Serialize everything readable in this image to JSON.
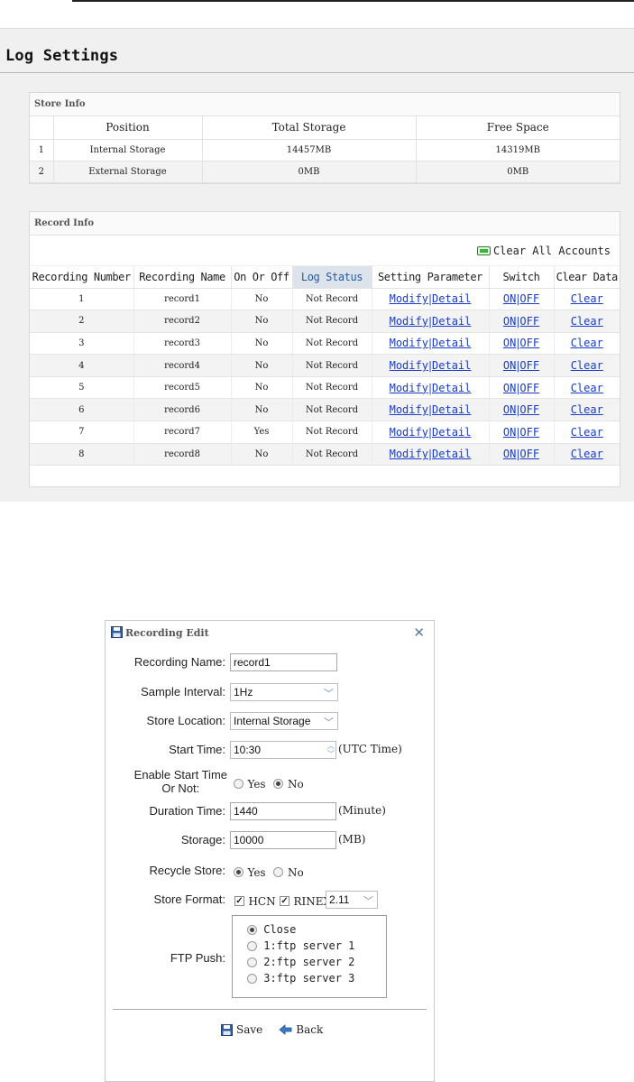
{
  "log_settings": {
    "title": "Log Settings",
    "store_info": {
      "heading": "Store Info",
      "columns": [
        "",
        "Position",
        "Total Storage",
        "Free Space"
      ],
      "rows": [
        {
          "index": "1",
          "position": "Internal Storage",
          "total": "14457MB",
          "free": "14319MB"
        },
        {
          "index": "2",
          "position": "External Storage",
          "total": "0MB",
          "free": "0MB"
        }
      ]
    },
    "record_info": {
      "heading": "Record Info",
      "clear_all_label": "Clear All Accounts",
      "columns": [
        "Recording Number",
        "Recording Name",
        "On Or Off",
        "Log Status",
        "Setting Parameter",
        "Switch",
        "Clear Data"
      ],
      "rows": [
        {
          "number": "1",
          "name": "record1",
          "on_off": "No",
          "status": "Not Record",
          "modify": "Modify",
          "detail": "Detail",
          "on": "ON",
          "off": "OFF",
          "clear": "Clear"
        },
        {
          "number": "2",
          "name": "record2",
          "on_off": "No",
          "status": "Not Record",
          "modify": "Modify",
          "detail": "Detail",
          "on": "ON",
          "off": "OFF",
          "clear": "Clear"
        },
        {
          "number": "3",
          "name": "record3",
          "on_off": "No",
          "status": "Not Record",
          "modify": "Modify",
          "detail": "Detail",
          "on": "ON",
          "off": "OFF",
          "clear": "Clear"
        },
        {
          "number": "4",
          "name": "record4",
          "on_off": "No",
          "status": "Not Record",
          "modify": "Modify",
          "detail": "Detail",
          "on": "ON",
          "off": "OFF",
          "clear": "Clear"
        },
        {
          "number": "5",
          "name": "record5",
          "on_off": "No",
          "status": "Not Record",
          "modify": "Modify",
          "detail": "Detail",
          "on": "ON",
          "off": "OFF",
          "clear": "Clear"
        },
        {
          "number": "6",
          "name": "record6",
          "on_off": "No",
          "status": "Not Record",
          "modify": "Modify",
          "detail": "Detail",
          "on": "ON",
          "off": "OFF",
          "clear": "Clear"
        },
        {
          "number": "7",
          "name": "record7",
          "on_off": "Yes",
          "status": "Not Record",
          "modify": "Modify",
          "detail": "Detail",
          "on": "ON",
          "off": "OFF",
          "clear": "Clear"
        },
        {
          "number": "8",
          "name": "record8",
          "on_off": "No",
          "status": "Not Record",
          "modify": "Modify",
          "detail": "Detail",
          "on": "ON",
          "off": "OFF",
          "clear": "Clear"
        }
      ]
    }
  },
  "recording_edit": {
    "title": "Recording Edit",
    "fields": {
      "recording_name": {
        "label": "Recording Name:",
        "value": "record1"
      },
      "sample_interval": {
        "label": "Sample Interval:",
        "value": "1Hz"
      },
      "store_location": {
        "label": "Store Location:",
        "value": "Internal Storage"
      },
      "start_time": {
        "label": "Start Time:",
        "value": "10:30",
        "unit": "(UTC Time)"
      },
      "enable_start_time": {
        "label_line1": "Enable Start Time",
        "label_line2": "Or Not:",
        "yes": "Yes",
        "no": "No",
        "selected": "No"
      },
      "duration_time": {
        "label": "Duration Time:",
        "value": "1440",
        "unit": "(Minute)"
      },
      "storage": {
        "label": "Storage:",
        "value": "10000",
        "unit": "(MB)"
      },
      "recycle_store": {
        "label": "Recycle Store:",
        "yes": "Yes",
        "no": "No",
        "selected": "Yes"
      },
      "store_format": {
        "label": "Store Format:",
        "hcn": "HCN",
        "rinex": "RINEX",
        "rinex_version": "2.11"
      },
      "ftp_push": {
        "label": "FTP Push:",
        "options": [
          "Close",
          "1:ftp server 1",
          "2:ftp server 2",
          "3:ftp server 3"
        ],
        "selected": "Close"
      }
    },
    "save_label": "Save",
    "back_label": "Back"
  },
  "colors": {
    "link": "#1a3cc8",
    "panel_bg": "#f0f0f0",
    "header_highlight": "#dde3ea",
    "accent_icon": "#6a8fc0"
  }
}
